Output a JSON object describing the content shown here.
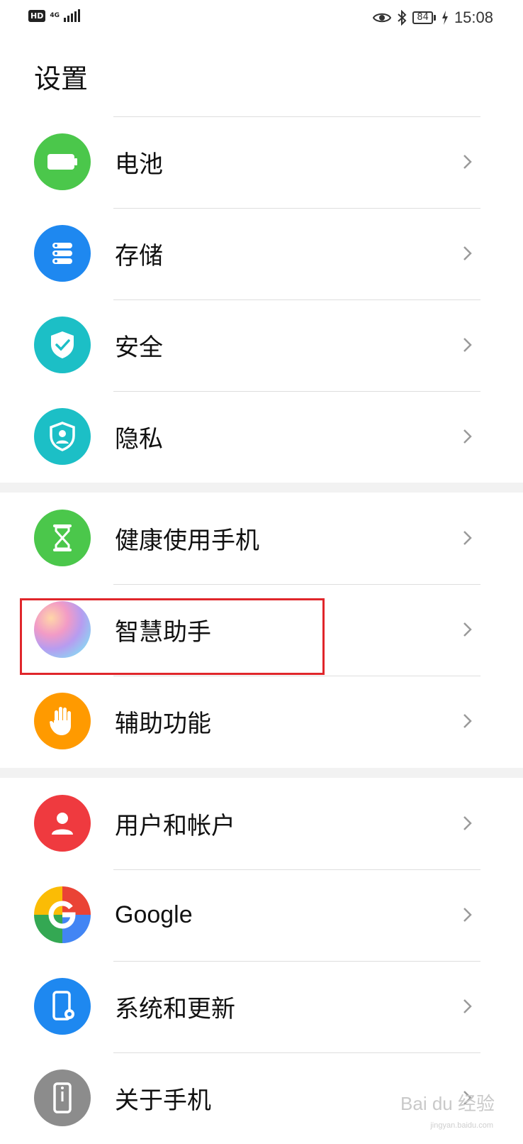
{
  "status_bar": {
    "hd": "HD",
    "network": "4G",
    "battery": "84",
    "time": "15:08"
  },
  "page": {
    "title": "设置"
  },
  "items": [
    {
      "label": "电池",
      "icon": "battery-icon",
      "color": "#4bc74b"
    },
    {
      "label": "存储",
      "icon": "storage-icon",
      "color": "#1e88f0"
    },
    {
      "label": "安全",
      "icon": "shield-check-icon",
      "color": "#1cbfc6"
    },
    {
      "label": "隐私",
      "icon": "privacy-icon",
      "color": "#1cbfc6"
    },
    {
      "label": "健康使用手机",
      "icon": "hourglass-icon",
      "color": "#4bc74b"
    },
    {
      "label": "智慧助手",
      "icon": "assistant-orb-icon",
      "color": "#c7b6ef"
    },
    {
      "label": "辅助功能",
      "icon": "hand-icon",
      "color": "#ff9a00"
    },
    {
      "label": "用户和帐户",
      "icon": "user-icon",
      "color": "#ef3a3f"
    },
    {
      "label": "Google",
      "icon": "google-icon",
      "color": "#4285f4"
    },
    {
      "label": "系统和更新",
      "icon": "system-update-icon",
      "color": "#1e88f0"
    },
    {
      "label": "关于手机",
      "icon": "about-phone-icon",
      "color": "#8c8c8c"
    }
  ],
  "watermark": {
    "text": "Bai du 经验",
    "sub": "jingyan.baidu.com"
  }
}
